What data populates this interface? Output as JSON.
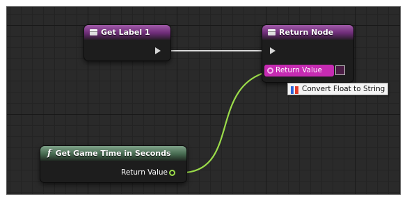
{
  "colors": {
    "canvas": "#2a2a2a",
    "string_pin": "#c735b3",
    "float_pin": "#9bdc4a",
    "function_header": "#466a50",
    "event_header": "#6e2c78"
  },
  "nodes": {
    "get_label": {
      "title": "Get Label 1",
      "icon": "function-entry-icon"
    },
    "return_node": {
      "title": "Return Node",
      "icon": "function-result-icon",
      "return_value_label": "Return Value"
    },
    "get_game_time": {
      "title": "Get Game Time in Seconds",
      "icon": "function-f-icon",
      "icon_glyph": "f",
      "return_value_label": "Return Value"
    }
  },
  "tooltip": {
    "text": "Convert Float to String",
    "icon": "conversion-icon"
  }
}
